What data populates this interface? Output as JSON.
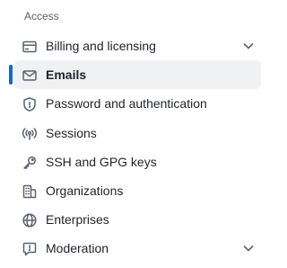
{
  "section": {
    "title": "Access"
  },
  "nav": {
    "items": [
      {
        "label": "Billing and licensing",
        "icon": "credit-card-icon",
        "expandable": true,
        "active": false
      },
      {
        "label": "Emails",
        "icon": "mail-icon",
        "expandable": false,
        "active": true
      },
      {
        "label": "Password and authentication",
        "icon": "shield-lock-icon",
        "expandable": false,
        "active": false
      },
      {
        "label": "Sessions",
        "icon": "broadcast-icon",
        "expandable": false,
        "active": false
      },
      {
        "label": "SSH and GPG keys",
        "icon": "key-icon",
        "expandable": false,
        "active": false
      },
      {
        "label": "Organizations",
        "icon": "organization-icon",
        "expandable": false,
        "active": false
      },
      {
        "label": "Enterprises",
        "icon": "globe-icon",
        "expandable": false,
        "active": false
      },
      {
        "label": "Moderation",
        "icon": "report-icon",
        "expandable": true,
        "active": false
      }
    ]
  },
  "colors": {
    "accent": "#0969da",
    "active_bg": "#eff1f3",
    "text": "#1f2328",
    "muted": "#59636e"
  }
}
